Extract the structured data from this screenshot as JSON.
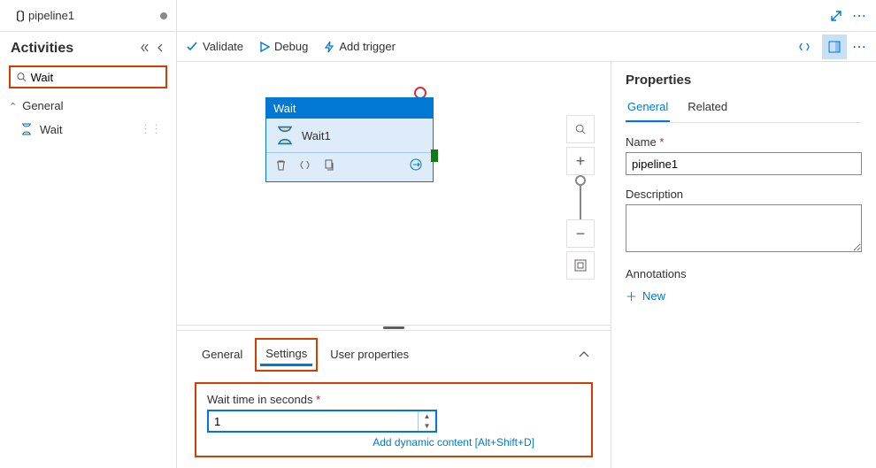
{
  "tab": {
    "title": "pipeline1"
  },
  "sidebar": {
    "heading": "Activities",
    "search_value": "Wait",
    "group": "General",
    "items": [
      {
        "label": "Wait"
      }
    ]
  },
  "toolbar": {
    "validate": "Validate",
    "debug": "Debug",
    "add_trigger": "Add trigger"
  },
  "canvas": {
    "node": {
      "type": "Wait",
      "name": "Wait1"
    }
  },
  "bottom": {
    "tabs": {
      "general": "General",
      "settings": "Settings",
      "user_properties": "User properties"
    },
    "wait_label": "Wait time in seconds",
    "wait_value": "1",
    "dynamic": "Add dynamic content [Alt+Shift+D]"
  },
  "props": {
    "title": "Properties",
    "tabs": {
      "general": "General",
      "related": "Related"
    },
    "name_label": "Name",
    "name_value": "pipeline1",
    "desc_label": "Description",
    "desc_value": "",
    "ann_label": "Annotations",
    "new_label": "New"
  }
}
